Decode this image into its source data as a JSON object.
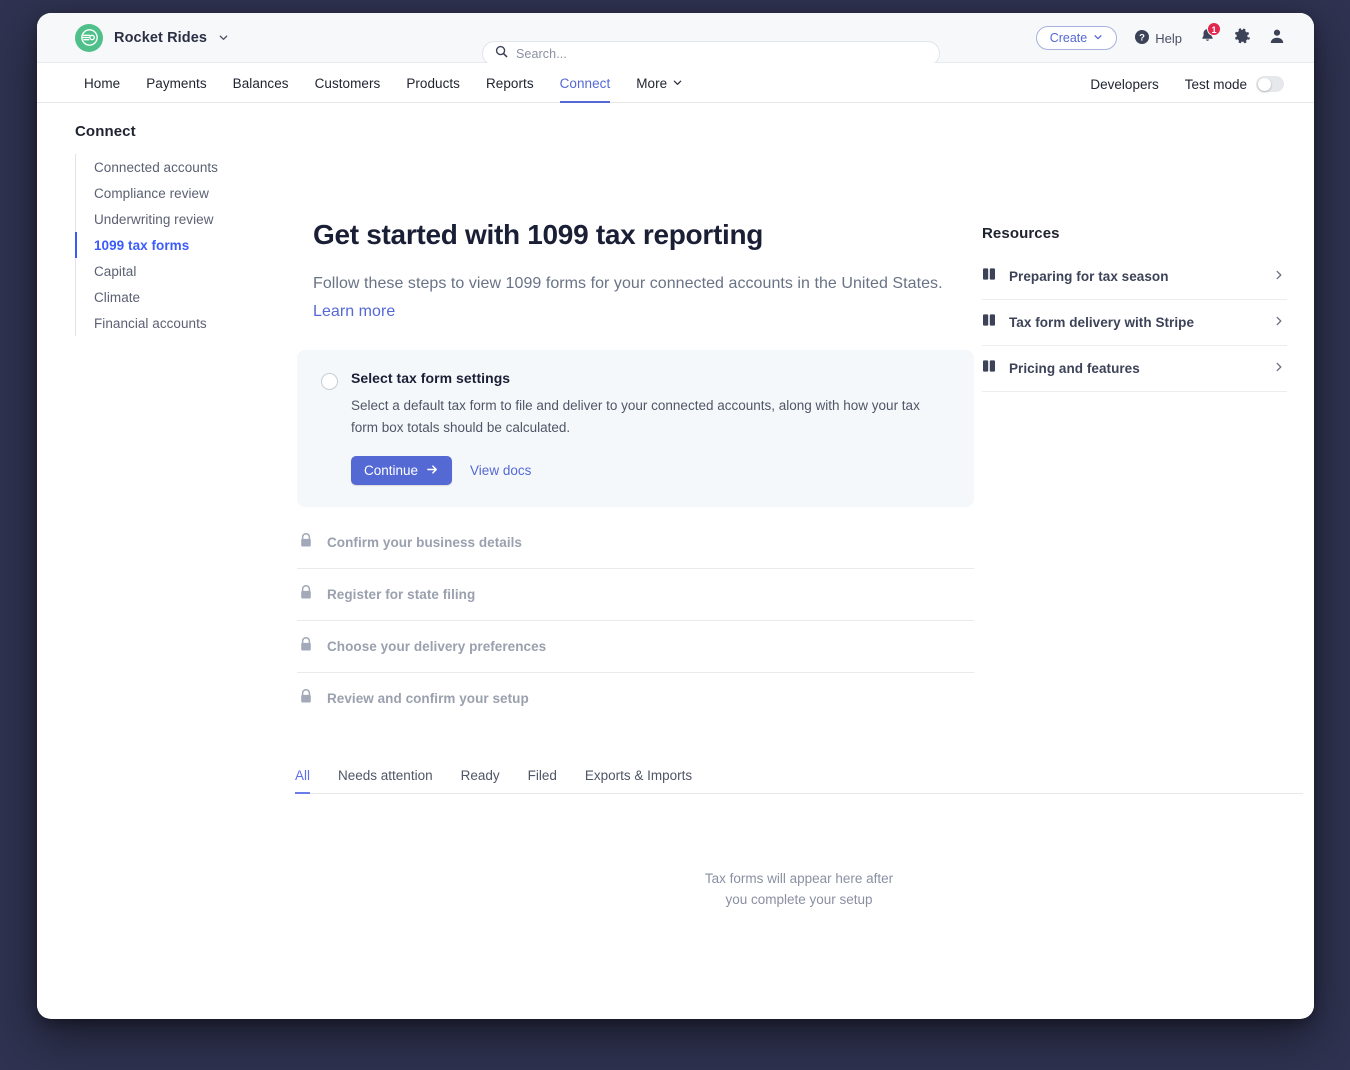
{
  "topbar": {
    "brand_name": "Rocket Rides",
    "brand_logo_icon": "rocket-rides-logo",
    "brand_caret_icon": "chevron-down-icon",
    "search": {
      "placeholder": "Search...",
      "value": "",
      "icon": "search-icon"
    },
    "create_label": "Create",
    "create_caret_icon": "chevron-down-icon",
    "help_label": "Help",
    "help_icon": "question-circle-icon",
    "notifications_icon": "bell-icon",
    "notifications_count": "1",
    "settings_icon": "gear-icon",
    "account_icon": "user-avatar-icon"
  },
  "nav": {
    "items": [
      {
        "label": "Home",
        "active": false,
        "caret": false
      },
      {
        "label": "Payments",
        "active": false,
        "caret": false
      },
      {
        "label": "Balances",
        "active": false,
        "caret": false
      },
      {
        "label": "Customers",
        "active": false,
        "caret": false
      },
      {
        "label": "Products",
        "active": false,
        "caret": false
      },
      {
        "label": "Reports",
        "active": false,
        "caret": false
      },
      {
        "label": "Connect",
        "active": true,
        "caret": false
      },
      {
        "label": "More",
        "active": false,
        "caret": true
      }
    ],
    "developers_label": "Developers",
    "test_mode_label": "Test mode",
    "test_mode_on": false
  },
  "sidebar": {
    "title": "Connect",
    "items": [
      {
        "label": "Connected accounts",
        "active": false
      },
      {
        "label": "Compliance review",
        "active": false
      },
      {
        "label": "Underwriting review",
        "active": false
      },
      {
        "label": "1099 tax forms",
        "active": true
      },
      {
        "label": "Capital",
        "active": false
      },
      {
        "label": "Climate",
        "active": false
      },
      {
        "label": "Financial accounts",
        "active": false
      }
    ]
  },
  "main": {
    "title": "Get started with 1099 tax reporting",
    "subtitle": "Follow these steps to view 1099 forms for your connected accounts in the United States. ",
    "subtitle_link": "Learn more",
    "active_step": {
      "radio_icon": "radio-unchecked-icon",
      "title": "Select tax form settings",
      "description": "Select a default tax form to file and deliver to your connected accounts, along with how your tax form box totals should be calculated.",
      "primary_label": "Continue",
      "primary_icon": "arrow-right-icon",
      "secondary_label": "View docs"
    },
    "locked_steps": [
      {
        "label": "Confirm your business details",
        "icon": "lock-icon"
      },
      {
        "label": "Register for state filing",
        "icon": "lock-icon"
      },
      {
        "label": "Choose your delivery preferences",
        "icon": "lock-icon"
      },
      {
        "label": "Review and confirm your setup",
        "icon": "lock-icon"
      }
    ],
    "tabs": [
      {
        "label": "All",
        "active": true
      },
      {
        "label": "Needs attention",
        "active": false
      },
      {
        "label": "Ready",
        "active": false
      },
      {
        "label": "Filed",
        "active": false
      },
      {
        "label": "Exports & Imports",
        "active": false
      }
    ],
    "empty_line1": "Tax forms will appear here after",
    "empty_line2": "you complete your setup"
  },
  "resources": {
    "title": "Resources",
    "items": [
      {
        "label": "Preparing for tax season",
        "icon": "book-icon",
        "chevron": "chevron-right-icon"
      },
      {
        "label": "Tax form delivery with Stripe",
        "icon": "book-icon",
        "chevron": "chevron-right-icon"
      },
      {
        "label": "Pricing and features",
        "icon": "book-icon",
        "chevron": "chevron-right-icon"
      }
    ]
  },
  "colors": {
    "accent": "#5469d4",
    "active_link": "#3b5bfd",
    "brand_green": "#4fc08a",
    "badge_red": "#e1274b",
    "page_background": "#2f3250",
    "card_background": "#f5f8fb"
  }
}
